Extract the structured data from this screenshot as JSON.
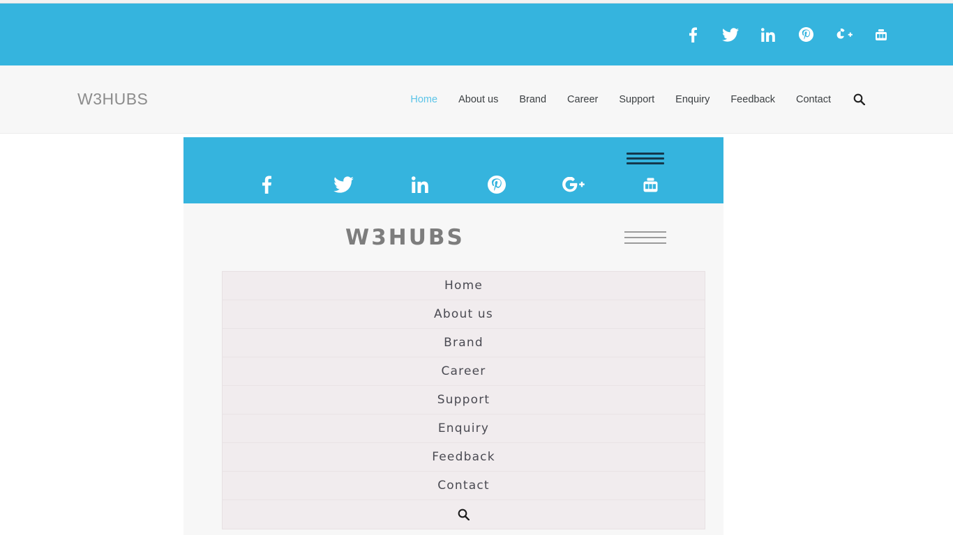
{
  "colors": {
    "accent_blue": "#35b4de",
    "nav_active": "#5bc4e8",
    "nav_bg": "#f7f7f7",
    "menu_row_bg": "#f1ecee",
    "hamburger_dark": "#14384c",
    "hamburger_gray": "#9b9b9b",
    "text_dark": "#3c4043",
    "brand_gray": "#8c8c8c"
  },
  "desktop": {
    "brand": "W3HUBS",
    "social": [
      {
        "name": "facebook-icon",
        "label": "Facebook"
      },
      {
        "name": "twitter-icon",
        "label": "Twitter"
      },
      {
        "name": "linkedin-icon",
        "label": "LinkedIn"
      },
      {
        "name": "pinterest-icon",
        "label": "Pinterest"
      },
      {
        "name": "googleplus-icon",
        "label": "Google Plus"
      },
      {
        "name": "youtube-icon",
        "label": "YouTube"
      }
    ],
    "nav": [
      {
        "label": "Home",
        "active": true
      },
      {
        "label": "About us",
        "active": false
      },
      {
        "label": "Brand",
        "active": false
      },
      {
        "label": "Career",
        "active": false
      },
      {
        "label": "Support",
        "active": false
      },
      {
        "label": "Enquiry",
        "active": false
      },
      {
        "label": "Feedback",
        "active": false
      },
      {
        "label": "Contact",
        "active": false
      }
    ],
    "search_icon": "search-icon"
  },
  "mobile_preview": {
    "brand": "W3HUBS",
    "hamburger_top": "menu-toggle",
    "hamburger_logo": "menu-toggle",
    "social": [
      {
        "name": "facebook-icon",
        "label": "Facebook"
      },
      {
        "name": "twitter-icon",
        "label": "Twitter"
      },
      {
        "name": "linkedin-icon",
        "label": "LinkedIn"
      },
      {
        "name": "pinterest-icon",
        "label": "Pinterest"
      },
      {
        "name": "googleplus-icon",
        "label": "Google Plus"
      },
      {
        "name": "youtube-icon",
        "label": "YouTube"
      }
    ],
    "menu": [
      {
        "label": "Home"
      },
      {
        "label": "About us"
      },
      {
        "label": "Brand"
      },
      {
        "label": "Career"
      },
      {
        "label": "Support"
      },
      {
        "label": "Enquiry"
      },
      {
        "label": "Feedback"
      },
      {
        "label": "Contact"
      }
    ],
    "search_icon": "search-icon"
  }
}
